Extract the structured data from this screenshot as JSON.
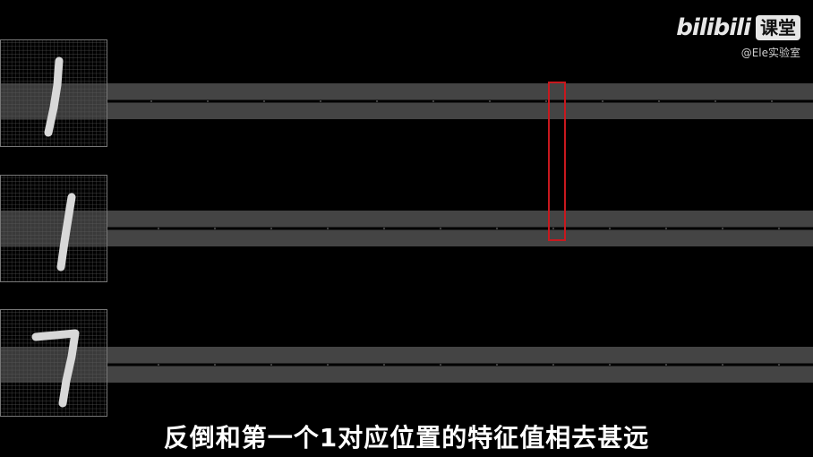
{
  "watermark": {
    "brand": "bilibili",
    "badge": "课堂",
    "author": "@Ele实验室"
  },
  "subtitle": "反倒和第一个1对应位置的特征值相去甚远",
  "rows": [
    {
      "digit": "1"
    },
    {
      "digit": "1"
    },
    {
      "digit": "7"
    }
  ],
  "highlight": {
    "color": "#c8181e"
  }
}
